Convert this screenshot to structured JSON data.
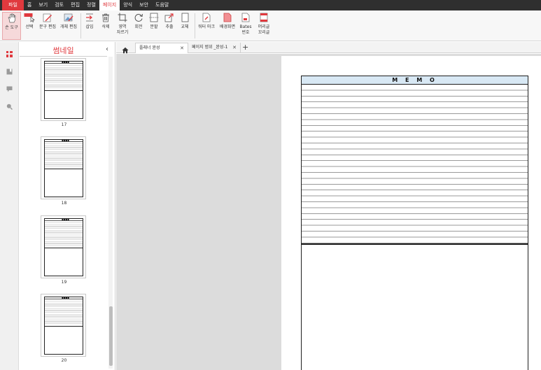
{
  "menu": {
    "file": "파일",
    "items": [
      "홈",
      "보기",
      "검토",
      "편집",
      "정렬",
      "페이지",
      "양식",
      "보안",
      "도움말"
    ],
    "active": "페이지"
  },
  "ribbon": {
    "hand_tool": "손 도구",
    "select": "선택",
    "text_edit": "문구 편집",
    "object_edit": "개체 편집",
    "insert": "삽입",
    "delete": "삭제",
    "crop": "영역\n자르기",
    "rotate": "회전",
    "split": "분할",
    "extract": "추출",
    "replace": "교체",
    "watermark": "워터 마크",
    "background": "배경화면",
    "bates": "Bates\n번호",
    "header_footer": "머리글\n꼬리글"
  },
  "sidebar": {
    "title": "썸네일",
    "pages": [
      "17",
      "18",
      "19",
      "20"
    ]
  },
  "tabs": {
    "doc1": "플래너 완성",
    "doc2": "페이지 범위 _완성-1",
    "add": "+"
  },
  "document": {
    "memo_title": "M E M O"
  },
  "colors": {
    "accent": "#e0393e",
    "memo_header": "#d8e8f4"
  }
}
